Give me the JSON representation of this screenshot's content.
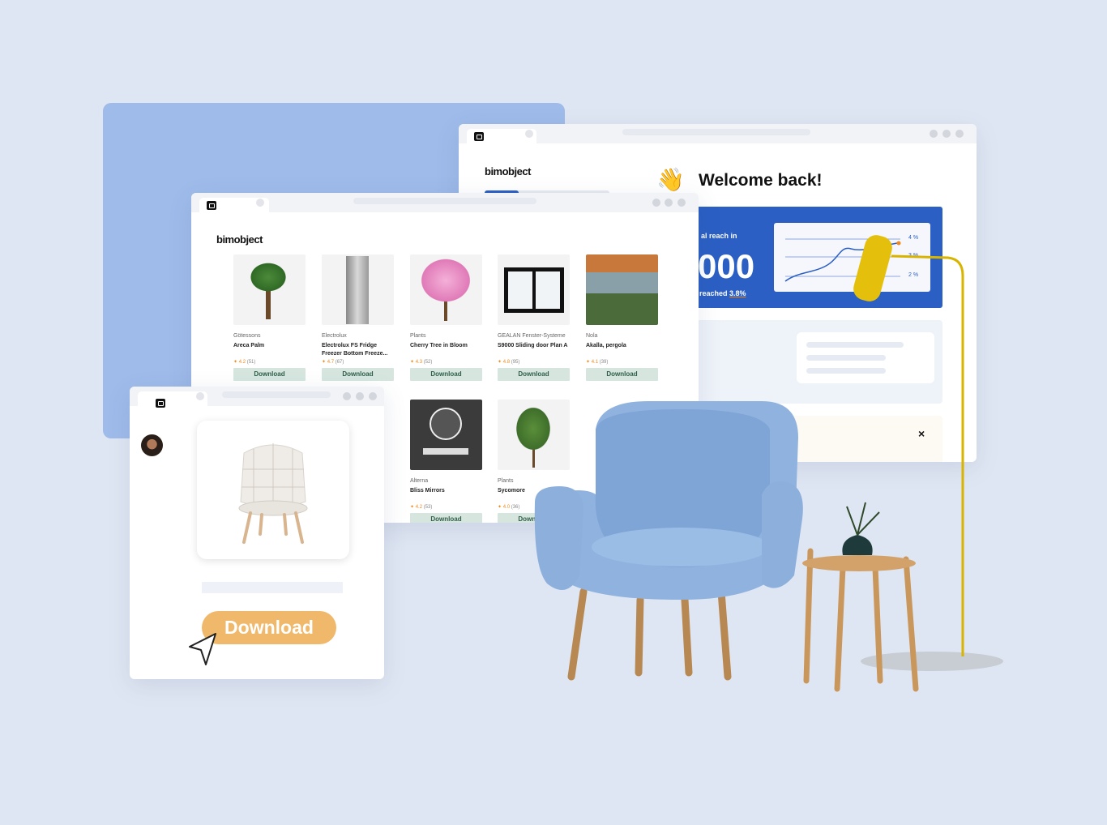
{
  "brand": {
    "logo": "bimobject"
  },
  "dashboard": {
    "greeting": "Welcome back!",
    "greeting_icon": "waving-hand-icon",
    "reach_label": "al reach in",
    "reach_value": "000",
    "reached_prefix": "reached",
    "reached_value": "3.8%",
    "chart_ticks": [
      "4 %",
      "3 %",
      "2 %"
    ],
    "close_label": "×",
    "accent": "#2b5fc4"
  },
  "catalog": {
    "products": [
      {
        "brand": "Götessons",
        "name": "Areca Palm",
        "rating": "4.2",
        "count": "(51)",
        "button": "Download"
      },
      {
        "brand": "Electrolux",
        "name": "Electrolux FS Fridge Freezer Bottom Freeze...",
        "rating": "4.7",
        "count": "(67)",
        "button": "Download"
      },
      {
        "brand": "Plants",
        "name": "Cherry Tree in Bloom",
        "rating": "4.3",
        "count": "(52)",
        "button": "Download"
      },
      {
        "brand": "GEALAN Fenster-Systeme",
        "name": "S9000 Sliding door Plan A",
        "rating": "4.8",
        "count": "(95)",
        "button": "Download"
      },
      {
        "brand": "Nola",
        "name": "Akalla, pergola",
        "rating": "4.1",
        "count": "(39)",
        "button": "Download"
      },
      {
        "brand": "Alterna",
        "name": "Bliss Mirrors",
        "rating": "4.2",
        "count": "(53)",
        "button": "Download"
      },
      {
        "brand": "Plants",
        "name": "Sycomore",
        "rating": "4.0",
        "count": "(36)",
        "button": "Download"
      }
    ],
    "button_color": "#d6e6df"
  },
  "detail": {
    "download_label": "Download",
    "button_color": "#f0b86a"
  }
}
